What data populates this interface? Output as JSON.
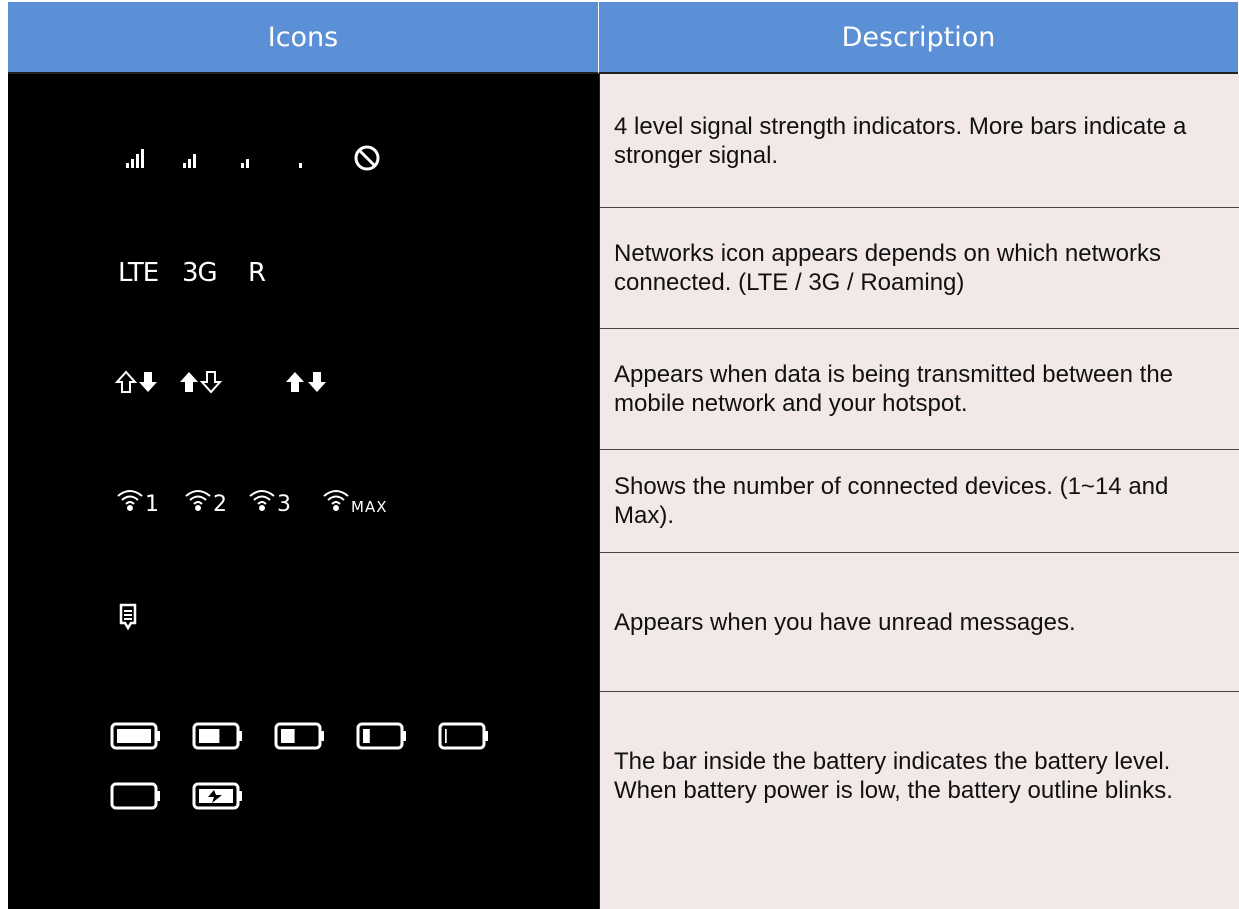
{
  "header": {
    "icons_label": "Icons",
    "description_label": "Description"
  },
  "rows": [
    {
      "description": "4 level signal strength indicators. More bars indicate a stronger signal.",
      "icons": [
        "signal-4-bars-icon",
        "signal-3-bars-icon",
        "signal-2-bars-icon",
        "signal-1-bar-icon",
        "no-signal-icon"
      ]
    },
    {
      "description": "Networks icon appears depends on which networks connected. (LTE / 3G / Roaming)",
      "network_labels": [
        "LTE",
        "3G",
        "R"
      ]
    },
    {
      "description": "Appears when data is being transmitted between the mobile network and your hotspot.",
      "icons": [
        "data-downloading-icon",
        "data-uploading-icon",
        "data-transferring-icon"
      ]
    },
    {
      "description": "Shows the number of connected devices. (1~14 and Max).",
      "device_counts": [
        "1",
        "2",
        "3",
        "MAX"
      ]
    },
    {
      "description": "Appears when you have unread messages.",
      "icons": [
        "message-icon"
      ]
    },
    {
      "description": "The bar inside the battery indicates the battery level. When battery power is low, the battery outline blinks.",
      "battery_levels": [
        1.0,
        0.6,
        0.4,
        0.2,
        0.05,
        0.0
      ],
      "icons": [
        "battery-charging-icon"
      ]
    }
  ],
  "colors": {
    "header_bg": "#5b8fd6",
    "icons_bg": "#000000",
    "description_bg": "#f3e8e8"
  }
}
